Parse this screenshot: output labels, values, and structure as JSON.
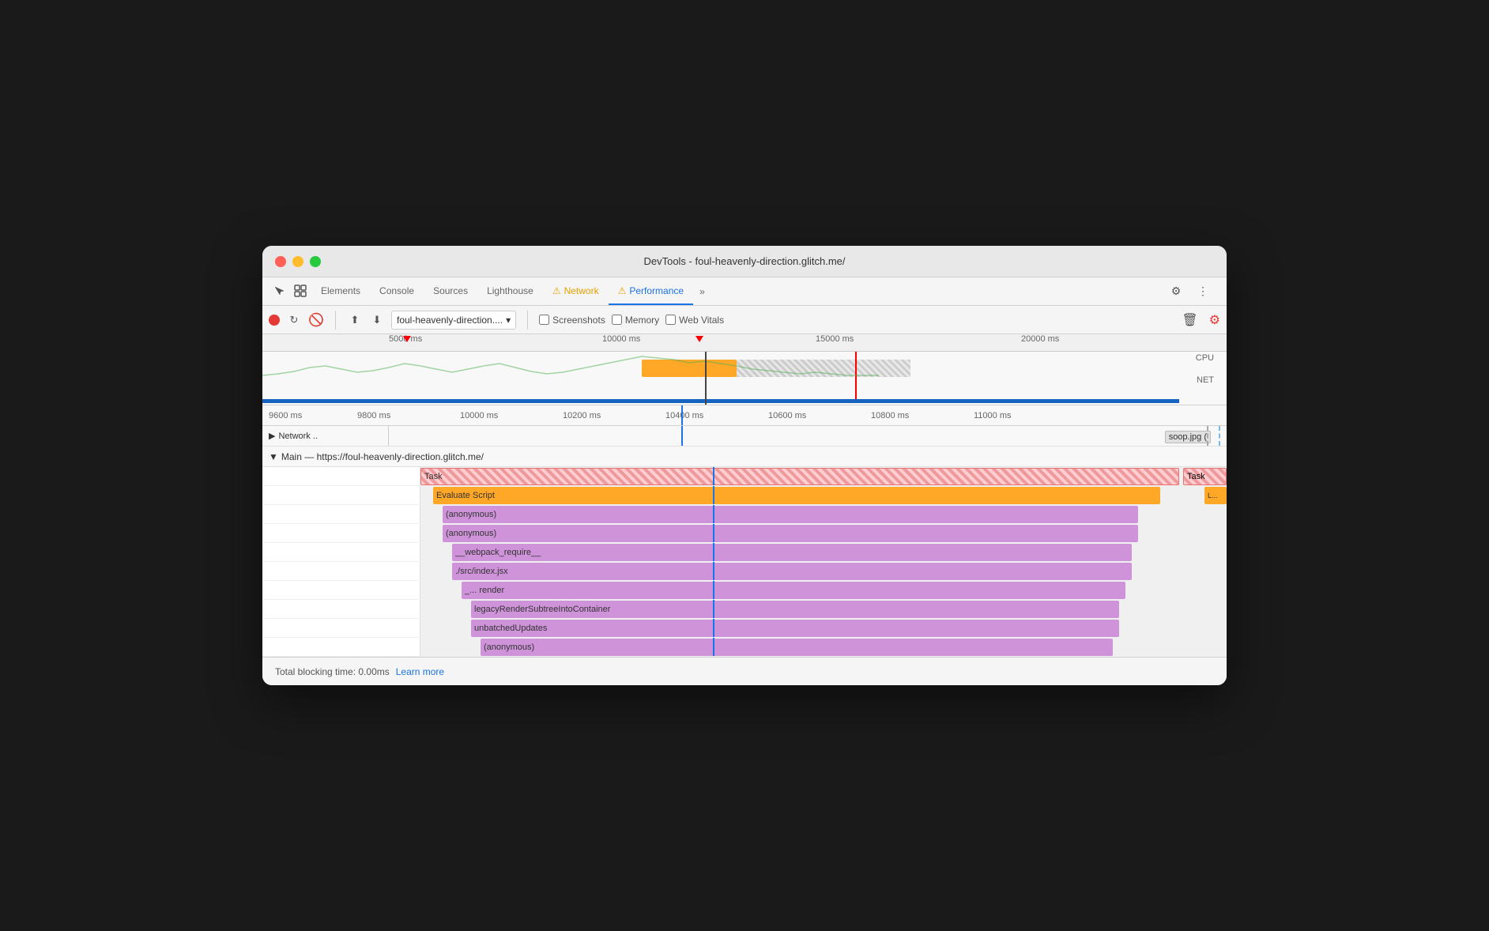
{
  "window": {
    "title": "DevTools - foul-heavenly-direction.glitch.me/",
    "controls": {
      "close": "●",
      "minimize": "●",
      "maximize": "●"
    }
  },
  "tabs": {
    "items": [
      {
        "label": "Elements",
        "active": false,
        "warning": false
      },
      {
        "label": "Console",
        "active": false,
        "warning": false
      },
      {
        "label": "Sources",
        "active": false,
        "warning": false
      },
      {
        "label": "Lighthouse",
        "active": false,
        "warning": false
      },
      {
        "label": "Network",
        "active": false,
        "warning": true
      },
      {
        "label": "Performance",
        "active": true,
        "warning": true
      }
    ],
    "more_label": "»"
  },
  "record_toolbar": {
    "url": "foul-heavenly-direction....",
    "screenshots_label": "Screenshots",
    "memory_label": "Memory",
    "web_vitals_label": "Web Vitals"
  },
  "timeline": {
    "ruler_marks": [
      "5000 ms",
      "10000 ms",
      "15000 ms",
      "20000 ms"
    ],
    "flamechart_marks": [
      "9600 ms",
      "9800 ms",
      "10000 ms",
      "10200 ms",
      "10400 ms",
      "10600 ms",
      "10800 ms",
      "11000 ms"
    ],
    "cpu_label": "CPU",
    "net_label": "NET"
  },
  "network": {
    "label": "Network ..",
    "soop_label": "soop.jpg ("
  },
  "main_section": {
    "label": "Main — https://foul-heavenly-direction.glitch.me/"
  },
  "flame_rows": [
    {
      "label": "Task",
      "type": "task",
      "indent": 0
    },
    {
      "label": "Evaluate Script",
      "type": "evaluate",
      "indent": 1
    },
    {
      "label": "(anonymous)",
      "type": "anon",
      "indent": 2
    },
    {
      "label": "(anonymous)",
      "type": "anon",
      "indent": 2
    },
    {
      "label": "__webpack_require__",
      "type": "webpack",
      "indent": 3
    },
    {
      "label": "./src/index.jsx",
      "type": "src",
      "indent": 3
    },
    {
      "label": "_...   render",
      "type": "render",
      "indent": 4
    },
    {
      "label": "legacyRenderSubtreeIntoContainer",
      "type": "legacy",
      "indent": 5
    },
    {
      "label": "unbatchedUpdates",
      "type": "unbatched",
      "indent": 5
    },
    {
      "label": "(anonymous)",
      "type": "anon",
      "indent": 6
    }
  ],
  "status_bar": {
    "blocking_time_label": "Total blocking time: 0.00ms",
    "learn_more_label": "Learn more"
  }
}
